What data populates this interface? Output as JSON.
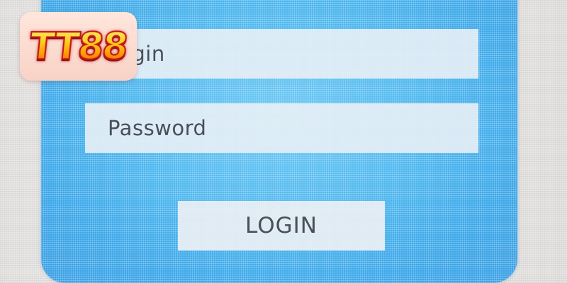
{
  "login_form": {
    "username_placeholder": "Login",
    "password_placeholder": "Password",
    "login_button_label": "LOGIN"
  },
  "logo": {
    "text": "TT88"
  },
  "colors": {
    "panel_blue": "#4cb6ee",
    "field_bg": "#e8f0f6",
    "text": "#4a4f57",
    "logo_outline": "#c0161b",
    "logo_fill": "#ffcc1a"
  }
}
